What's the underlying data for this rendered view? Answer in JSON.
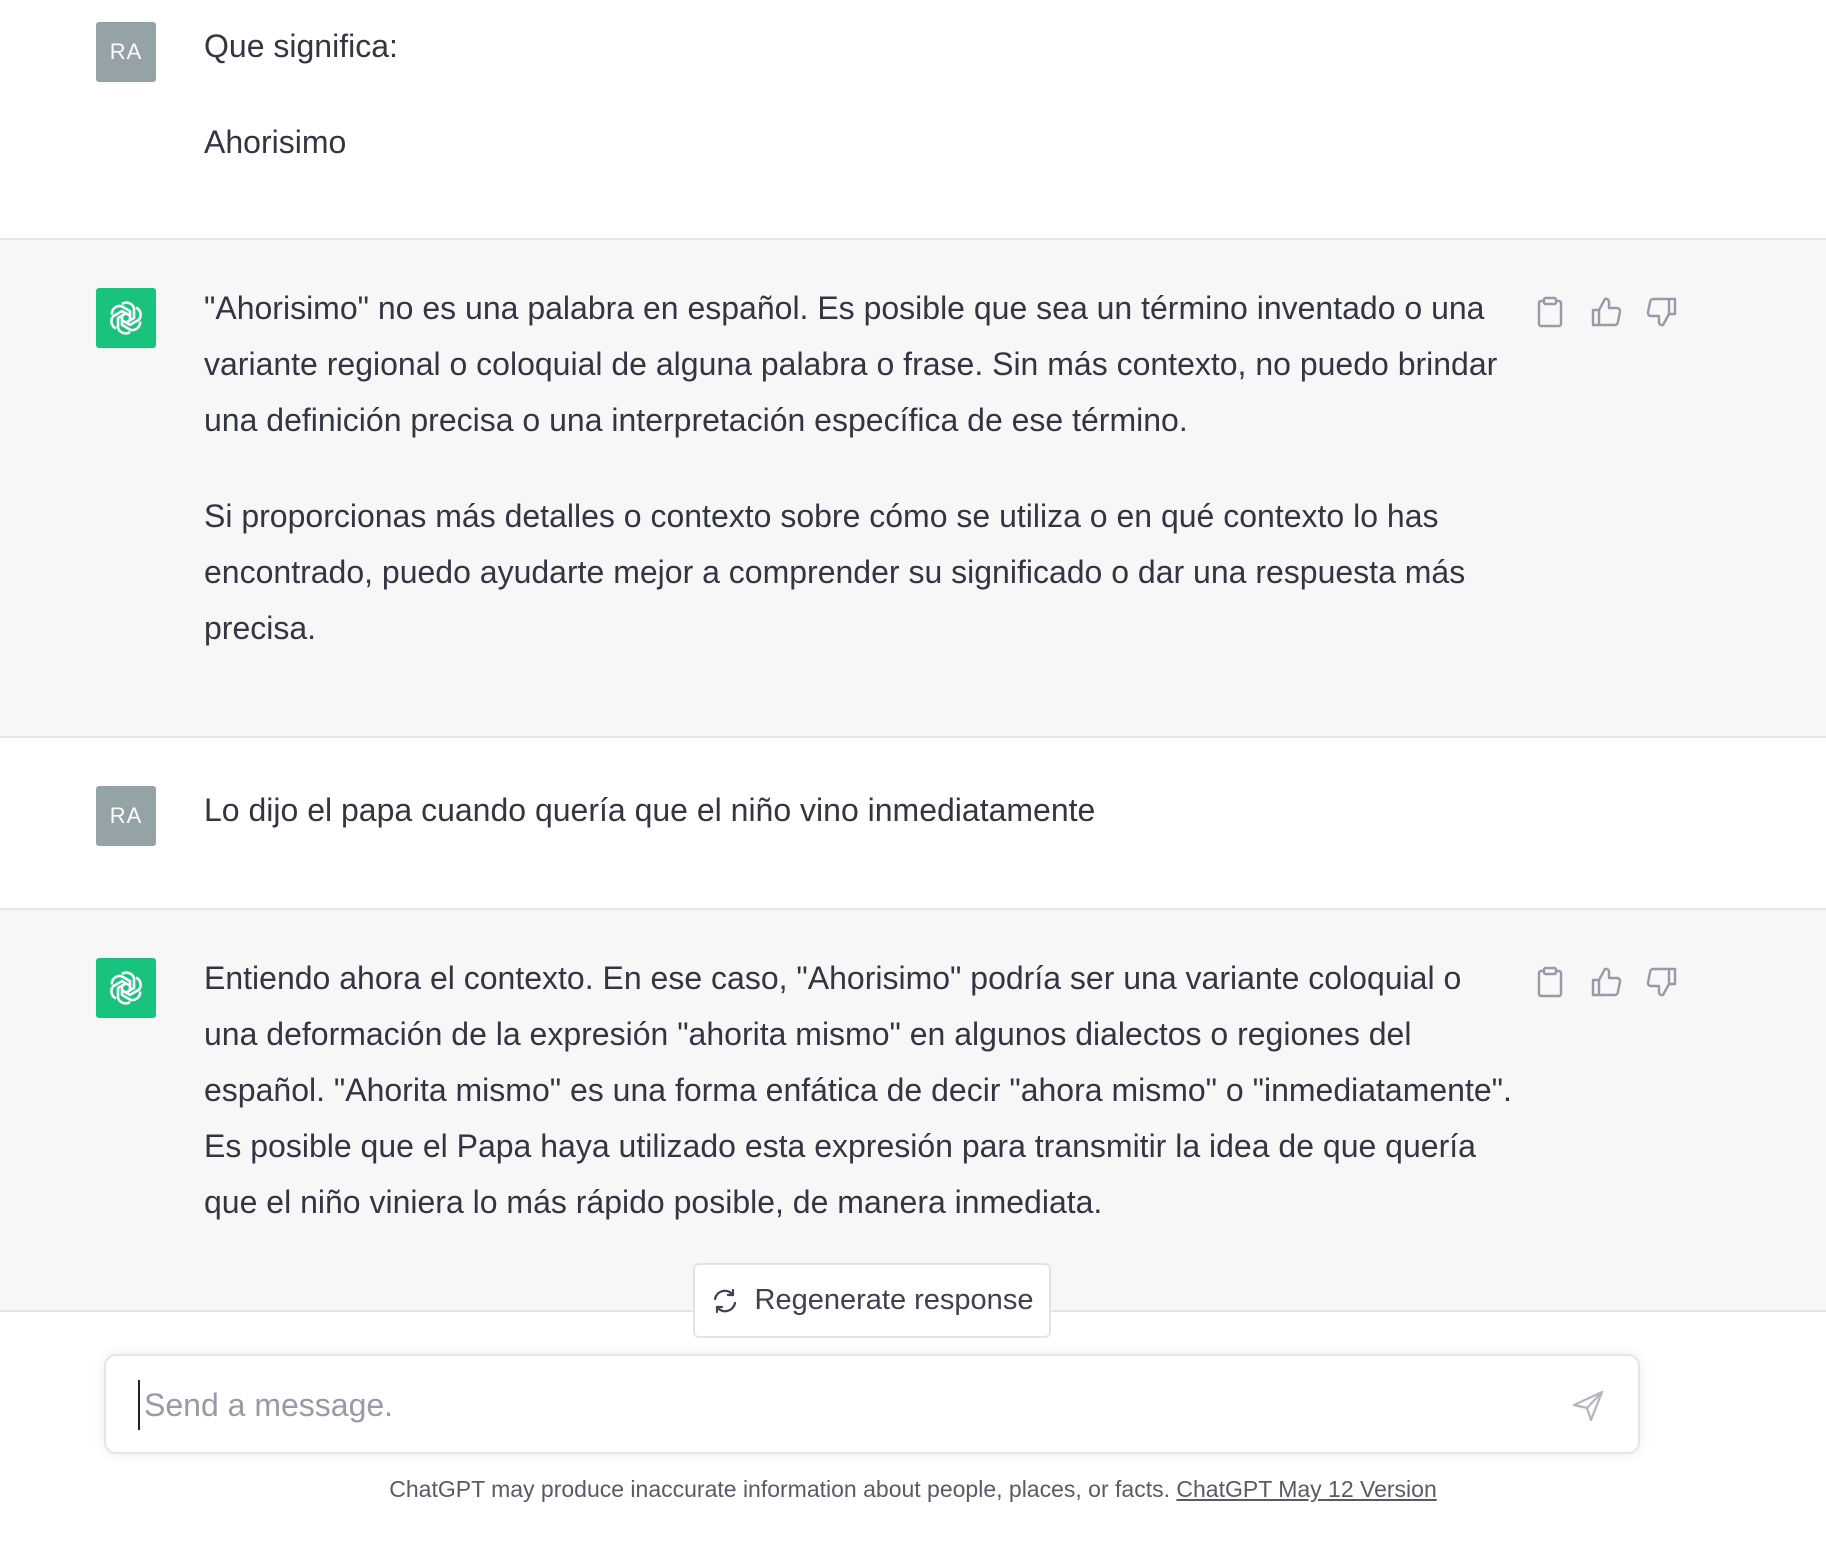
{
  "conversation": [
    {
      "role": "user",
      "avatar": "RA",
      "paragraphs": [
        "Que significa:",
        "Ahorisimo"
      ]
    },
    {
      "role": "assistant",
      "avatar_icon": "openai-logo-icon",
      "paragraphs": [
        "\"Ahorisimo\" no es una palabra en español. Es posible que sea un término inventado o una variante regional o coloquial de alguna palabra o frase. Sin más contexto, no puedo brindar una definición precisa o una interpretación específica de ese término.",
        "Si proporcionas más detalles o contexto sobre cómo se utiliza o en qué contexto lo has encontrado, puedo ayudarte mejor a comprender su significado o dar una respuesta más precisa."
      ],
      "actions": [
        "clipboard-icon",
        "thumbs-up-icon",
        "thumbs-down-icon"
      ]
    },
    {
      "role": "user",
      "avatar": "RA",
      "paragraphs": [
        "Lo dijo el papa cuando quería que el niño vino inmediatamente"
      ]
    },
    {
      "role": "assistant",
      "avatar_icon": "openai-logo-icon",
      "paragraphs": [
        "Entiendo ahora el contexto. En ese caso, \"Ahorisimo\" podría ser una variante coloquial o una deformación de la expresión \"ahorita mismo\" en algunos dialectos o regiones del español. \"Ahorita mismo\" es una forma enfática de decir \"ahora mismo\" o \"inmediatamente\". Es posible que el Papa haya utilizado esta expresión para transmitir la idea de que quería que el niño viniera lo más rápido posible, de manera inmediata."
      ],
      "actions": [
        "clipboard-icon",
        "thumbs-up-icon",
        "thumbs-down-icon"
      ]
    }
  ],
  "regenerate": {
    "label": "Regenerate response",
    "icon": "refresh-icon"
  },
  "composer": {
    "placeholder": "Send a message.",
    "value": "",
    "send_icon": "send-icon"
  },
  "footer": {
    "text": "ChatGPT may produce inaccurate information about people, places, or facts. ",
    "link_label": "ChatGPT May 12 Version"
  },
  "colors": {
    "assistant_bg": "#f7f7f8",
    "user_avatar_bg": "#95a3a6",
    "assistant_avatar_bg": "#19c37d",
    "text": "#343541"
  }
}
